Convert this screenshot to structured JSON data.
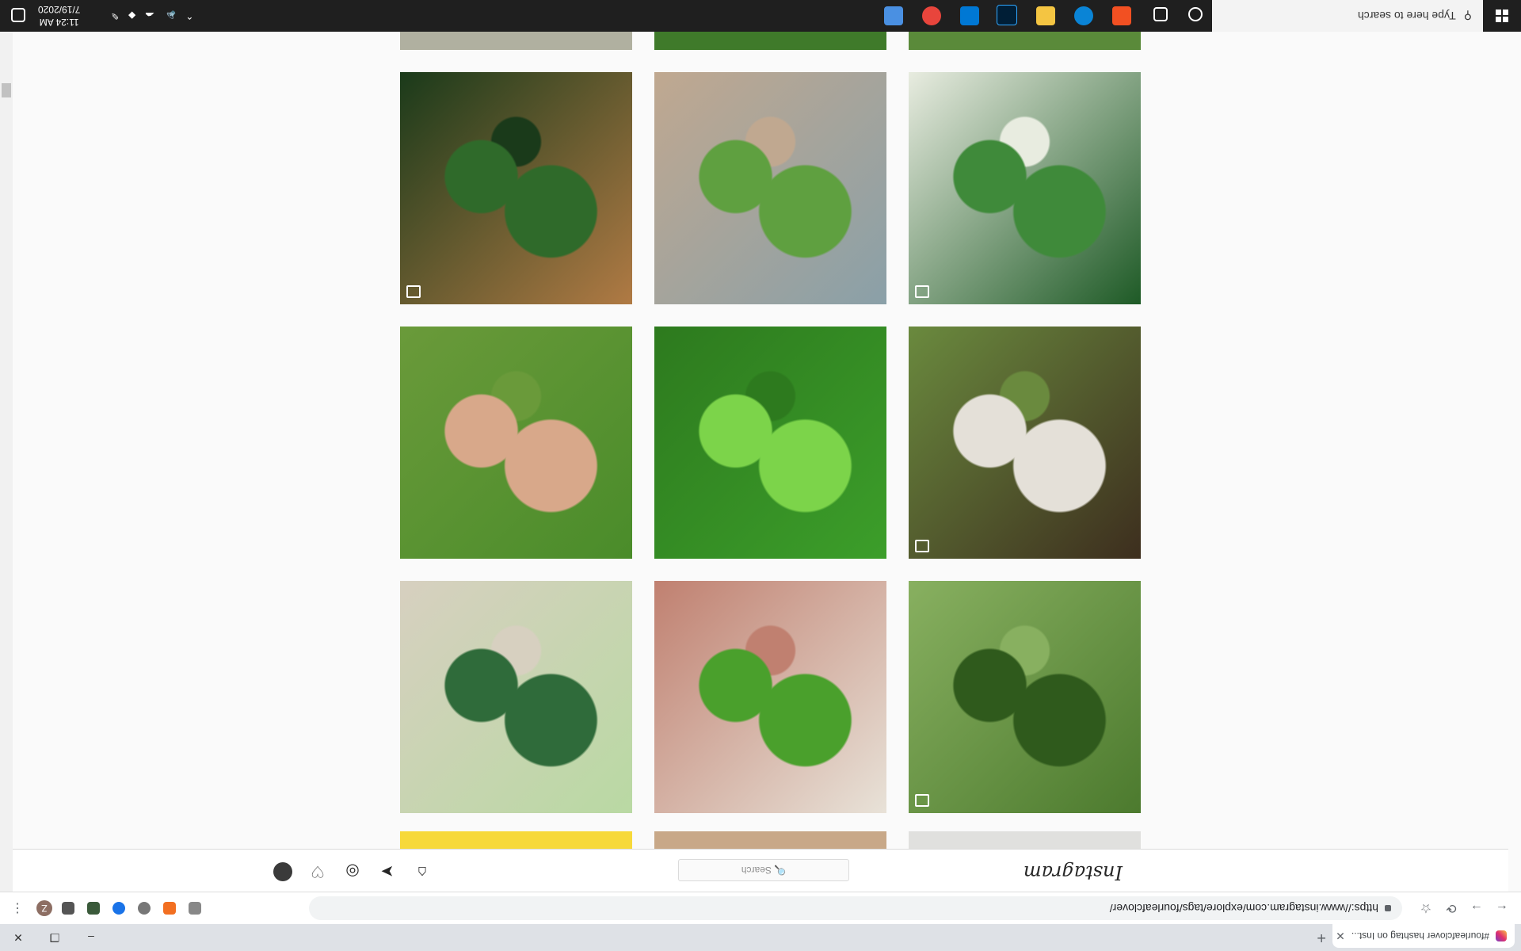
{
  "browser": {
    "tab_title": "#fourleafclover hashtag on Inst...",
    "tab_close": "✕",
    "new_tab": "+",
    "url": "https://www.instagram.com/explore/tags/fourleafclover/",
    "profile_initial": "Z",
    "back": "←",
    "forward": "→",
    "reload": "⟳",
    "minimize": "–",
    "restore": "❐",
    "close": "✕"
  },
  "instagram": {
    "logo": "Instagram",
    "search_placeholder": "🔍 Search"
  },
  "posts": [
    {
      "id": "r1c1",
      "colors": [
        "#4c7a2e",
        "#2f5a1c",
        "#88b060"
      ],
      "multi": true
    },
    {
      "id": "r1c2",
      "colors": [
        "#e8e2d8",
        "#4aa02c",
        "#c08070"
      ],
      "multi": false
    },
    {
      "id": "r1c3",
      "colors": [
        "#b9d9a3",
        "#2f6b3a",
        "#d7d0c0"
      ],
      "multi": false
    },
    {
      "id": "r2c1",
      "colors": [
        "#3d2e1e",
        "#e4e0d8",
        "#6a8a3e"
      ],
      "multi": true
    },
    {
      "id": "r2c2",
      "colors": [
        "#3c9e2a",
        "#7cd44a",
        "#2d7a1e"
      ],
      "multi": false
    },
    {
      "id": "r2c3",
      "colors": [
        "#4a8c2a",
        "#d8a88a",
        "#6a9a3a"
      ],
      "multi": false
    },
    {
      "id": "r3c1",
      "colors": [
        "#1e5a26",
        "#3f8a3a",
        "#e8ece0"
      ],
      "multi": true
    },
    {
      "id": "r3c2",
      "colors": [
        "#8aa0a8",
        "#5fa040",
        "#c0a890"
      ],
      "multi": false
    },
    {
      "id": "r3c3",
      "colors": [
        "#b07a44",
        "#2f6a2a",
        "#1a3a1a"
      ],
      "multi": true
    }
  ],
  "taskbar": {
    "search_text": "Type here to search",
    "time": "11:24 AM",
    "date": "7/19/2020"
  }
}
